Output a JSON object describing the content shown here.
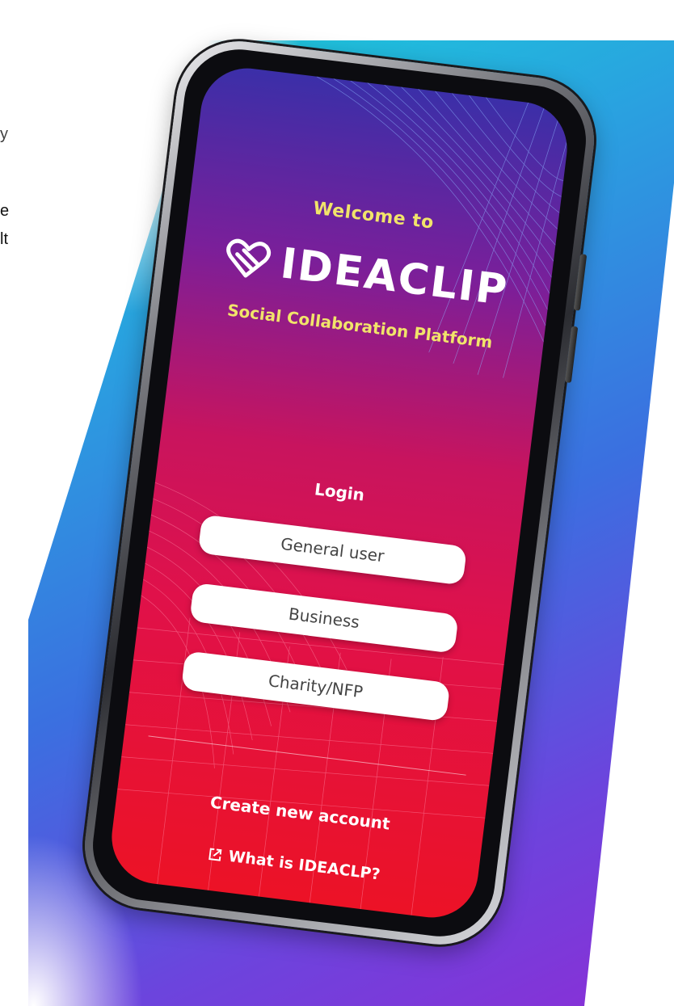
{
  "side_text": {
    "line1": "y",
    "line2": "e",
    "line3": "lt"
  },
  "screen": {
    "welcome": "Welcome to",
    "brand": "IDEACLIP",
    "tagline": "Social Collaboration Platform",
    "login_label": "Login",
    "buttons": [
      {
        "label": "General user"
      },
      {
        "label": "Business"
      },
      {
        "label": "Charity/NFP"
      }
    ],
    "create_account": "Create new account",
    "what_is": "What is IDEACLP?"
  },
  "colors": {
    "accent_yellow": "#f1e46a",
    "screen_top": "#3b2fa8",
    "screen_bottom": "#ec1226",
    "backdrop_cyan": "#19d3d9",
    "backdrop_purple": "#8a2fd6"
  },
  "icons": {
    "logo": "heart-clip-icon",
    "external_link": "external-link-icon"
  }
}
